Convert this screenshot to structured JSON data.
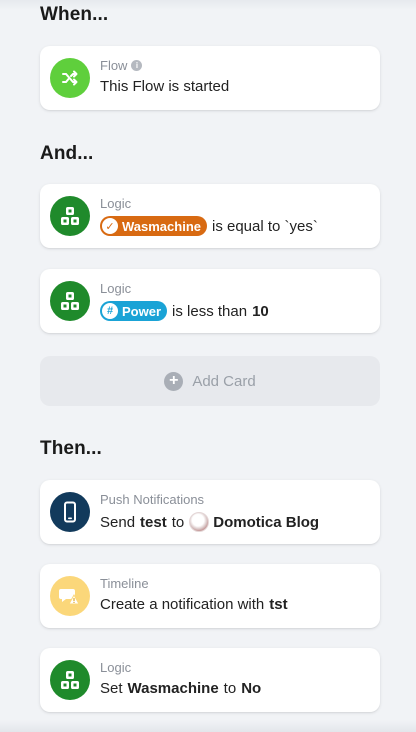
{
  "sections": {
    "when": "When...",
    "and": "And...",
    "then": "Then..."
  },
  "when_card": {
    "category": "Flow",
    "text": "This Flow is started",
    "icon": "shuffle-icon",
    "icon_color": "#5fcf3c"
  },
  "and_cards": [
    {
      "category": "Logic",
      "pill_label": "Wasmachine",
      "pill_icon": "check-circle-icon",
      "pill_color": "#d86a12",
      "text": "is equal to `yes`",
      "icon": "logic-icon",
      "icon_color": "#1f8a2b"
    },
    {
      "category": "Logic",
      "pill_label": "Power",
      "pill_icon": "hash-icon",
      "pill_color": "#1aa3d6",
      "text": "is less than",
      "value": "10",
      "icon": "logic-icon",
      "icon_color": "#1f8a2b"
    }
  ],
  "add_card": {
    "label": "Add Card"
  },
  "then_cards": [
    {
      "category": "Push Notifications",
      "prefix": "Send",
      "message": "test",
      "to": "to",
      "recipient": "Domotica Blog",
      "icon": "phone-icon",
      "icon_color": "#123a5c"
    },
    {
      "category": "Timeline",
      "prefix": "Create a notification with",
      "message": "tst",
      "icon": "timeline-warning-icon",
      "icon_color": "#fbd77a"
    },
    {
      "category": "Logic",
      "prefix": "Set",
      "variable": "Wasmachine",
      "to": "to",
      "value": "No",
      "icon": "logic-icon",
      "icon_color": "#1f8a2b"
    }
  ]
}
